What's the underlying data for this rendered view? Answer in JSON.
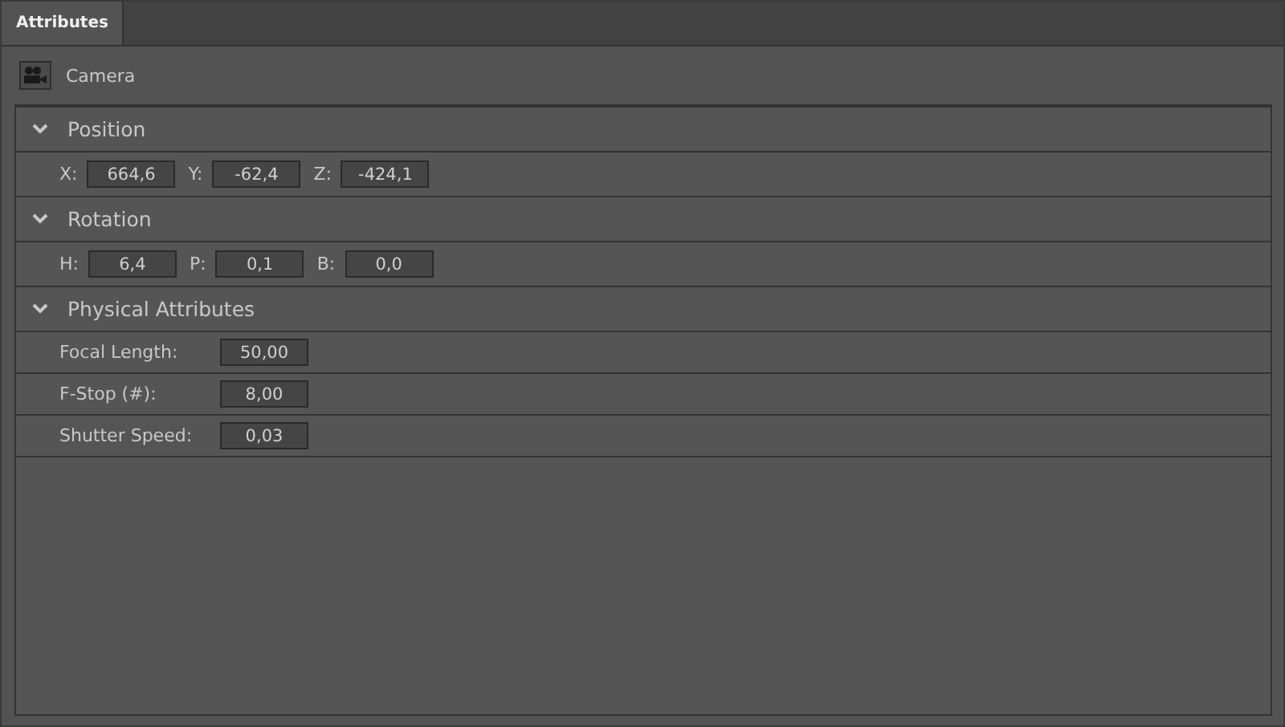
{
  "tabs": [
    {
      "label": "Attributes",
      "selected": true
    }
  ],
  "object": {
    "name": "Camera"
  },
  "sections": [
    {
      "title": "Position",
      "expanded": true,
      "kind": "inline",
      "fields": [
        {
          "label": "X:",
          "value": "664,6"
        },
        {
          "label": "Y:",
          "value": "-62,4"
        },
        {
          "label": "Z:",
          "value": "-424,1"
        }
      ]
    },
    {
      "title": "Rotation",
      "expanded": true,
      "kind": "inline",
      "fields": [
        {
          "label": "H:",
          "value": "6,4"
        },
        {
          "label": "P:",
          "value": "0,1"
        },
        {
          "label": "B:",
          "value": "0,0"
        }
      ]
    },
    {
      "title": "Physical Attributes",
      "expanded": true,
      "kind": "rows",
      "fields": [
        {
          "label": "Focal Length:",
          "value": "50,00"
        },
        {
          "label": "F-Stop (#):",
          "value": "8,00"
        },
        {
          "label": "Shutter Speed:",
          "value": "0,03"
        }
      ]
    }
  ]
}
